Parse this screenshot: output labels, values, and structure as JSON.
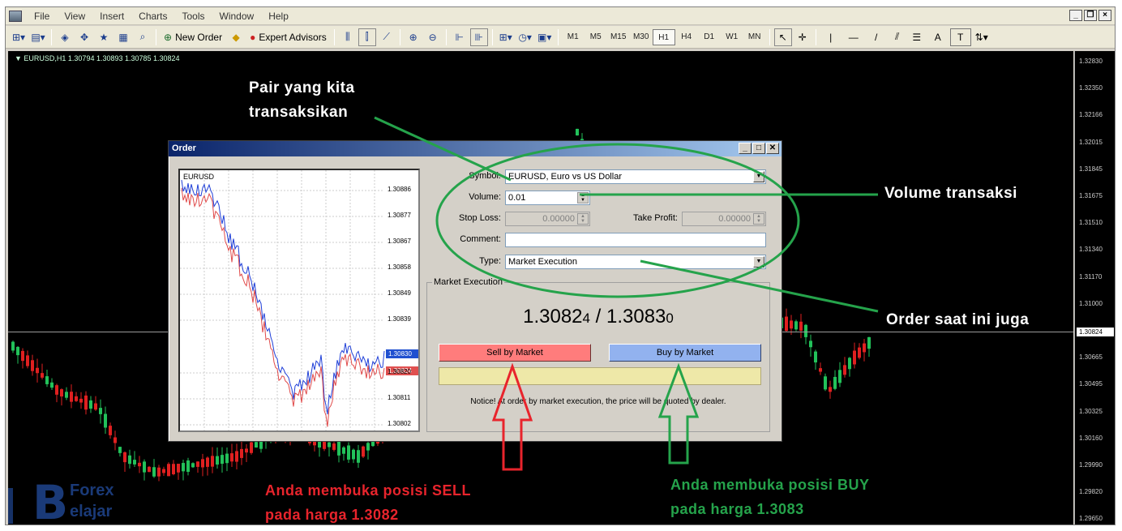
{
  "menu": [
    "File",
    "View",
    "Insert",
    "Charts",
    "Tools",
    "Window",
    "Help"
  ],
  "toolbar": {
    "new_order_label": "New Order",
    "expert_advisors_label": "Expert Advisors",
    "timeframes": [
      "M1",
      "M5",
      "M15",
      "M30",
      "H1",
      "H4",
      "D1",
      "W1",
      "MN"
    ],
    "active_timeframe": "H1",
    "tools": [
      "|",
      "—",
      "/",
      "A",
      "T"
    ]
  },
  "chart": {
    "info": "▼ EURUSD,H1  1.30794 1.30893 1.30785 1.30824",
    "price_labels": [
      "1.32830",
      "1.32350",
      "1.32166",
      "1.32015",
      "1.31845",
      "1.31675",
      "1.31510",
      "1.31340",
      "1.31170",
      "1.31000",
      "1.30824",
      "1.30665",
      "1.30495",
      "1.30325",
      "1.30160",
      "1.29990",
      "1.29820",
      "1.29650"
    ],
    "current_price": "1.30824"
  },
  "dialog": {
    "title": "Order",
    "mini_chart": {
      "symbol": "EURUSD",
      "axis_labels": [
        "1.30886",
        "1.30877",
        "1.30867",
        "1.30858",
        "1.30849",
        "1.30839",
        "1.30820",
        "1.30811",
        "1.30802"
      ],
      "ask_tag": "1.30830",
      "bid_tag": "1.30824"
    },
    "symbol_label": "Symbol:",
    "symbol_value": "EURUSD, Euro vs US Dollar",
    "volume_label": "Volume:",
    "volume_value": "0.01",
    "stop_loss_label": "Stop Loss:",
    "stop_loss_value": "0.00000",
    "take_profit_label": "Take Profit:",
    "take_profit_value": "0.00000",
    "comment_label": "Comment:",
    "comment_value": "",
    "type_label": "Type:",
    "type_value": "Market Execution",
    "group_title": "Market Execution",
    "bid_main": "1.3082",
    "bid_small": "4",
    "separator": " / ",
    "ask_main": "1.3083",
    "ask_small": "0",
    "sell_label": "Sell by Market",
    "buy_label": "Buy by Market",
    "notice": "Notice! At order by market execution, the price will be quoted by dealer."
  },
  "annotations": {
    "pair": [
      "Pair yang kita",
      "transaksikan"
    ],
    "volume": "Volume transaksi",
    "order": "Order saat ini juga",
    "sell": [
      "Anda membuka posisi SELL",
      "pada harga 1.3082"
    ],
    "buy": [
      "Anda membuka posisi BUY",
      "pada harga 1.3083"
    ]
  },
  "watermark": {
    "letter": "B",
    "line1": "Forex",
    "line2": "elajar"
  },
  "colors": {
    "sell": "#ff7c7c",
    "buy": "#92b2ef",
    "annotation_green": "#25a34b",
    "annotation_red": "#e8242c"
  }
}
